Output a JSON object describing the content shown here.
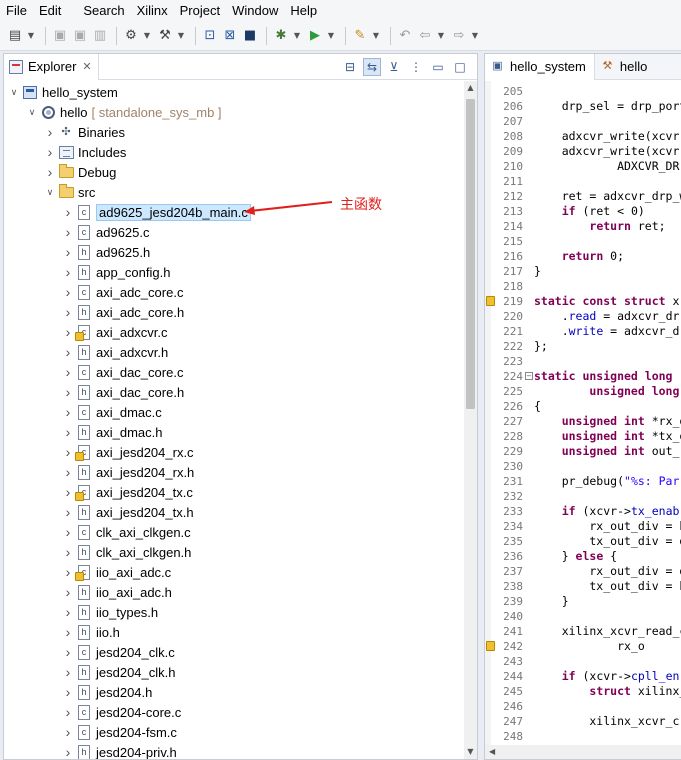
{
  "menu": [
    "File",
    "Edit",
    "Search",
    "Xilinx",
    "Project",
    "Window",
    "Help"
  ],
  "explorer": {
    "tab_label": "Explorer",
    "tree": [
      {
        "label": "hello_system",
        "sub": "",
        "icon": "project-icon",
        "depth": 0,
        "twisty": "expanded"
      },
      {
        "label": "hello",
        "sub": "[ standalone_sys_mb ]",
        "icon": "gear-icon",
        "depth": 1,
        "twisty": "expanded"
      },
      {
        "label": "Binaries",
        "sub": "",
        "icon": "binaries-icon",
        "depth": 2,
        "twisty": "collapsed"
      },
      {
        "label": "Includes",
        "sub": "",
        "icon": "includes-icon",
        "depth": 2,
        "twisty": "collapsed"
      },
      {
        "label": "Debug",
        "sub": "",
        "icon": "folder-icon",
        "depth": 2,
        "twisty": "collapsed"
      },
      {
        "label": "src",
        "sub": "",
        "icon": "folder-icon",
        "depth": 2,
        "twisty": "expanded"
      },
      {
        "label": "ad9625_jesd204b_main.c",
        "sub": "",
        "icon": "c-file-icon",
        "depth": 3,
        "twisty": "collapsed",
        "selected": true
      },
      {
        "label": "ad9625.c",
        "sub": "",
        "icon": "c-file-icon",
        "depth": 3,
        "twisty": "collapsed"
      },
      {
        "label": "ad9625.h",
        "sub": "",
        "icon": "h-file-icon",
        "depth": 3,
        "twisty": "collapsed"
      },
      {
        "label": "app_config.h",
        "sub": "",
        "icon": "h-file-icon",
        "depth": 3,
        "twisty": "collapsed"
      },
      {
        "label": "axi_adc_core.c",
        "sub": "",
        "icon": "c-file-icon",
        "depth": 3,
        "twisty": "collapsed"
      },
      {
        "label": "axi_adc_core.h",
        "sub": "",
        "icon": "h-file-icon",
        "depth": 3,
        "twisty": "collapsed"
      },
      {
        "label": "axi_adxcvr.c",
        "sub": "",
        "icon": "c-file-warning-icon",
        "depth": 3,
        "twisty": "collapsed"
      },
      {
        "label": "axi_adxcvr.h",
        "sub": "",
        "icon": "h-file-icon",
        "depth": 3,
        "twisty": "collapsed"
      },
      {
        "label": "axi_dac_core.c",
        "sub": "",
        "icon": "c-file-icon",
        "depth": 3,
        "twisty": "collapsed"
      },
      {
        "label": "axi_dac_core.h",
        "sub": "",
        "icon": "h-file-icon",
        "depth": 3,
        "twisty": "collapsed"
      },
      {
        "label": "axi_dmac.c",
        "sub": "",
        "icon": "c-file-icon",
        "depth": 3,
        "twisty": "collapsed"
      },
      {
        "label": "axi_dmac.h",
        "sub": "",
        "icon": "h-file-icon",
        "depth": 3,
        "twisty": "collapsed"
      },
      {
        "label": "axi_jesd204_rx.c",
        "sub": "",
        "icon": "c-file-warning-icon",
        "depth": 3,
        "twisty": "collapsed"
      },
      {
        "label": "axi_jesd204_rx.h",
        "sub": "",
        "icon": "h-file-icon",
        "depth": 3,
        "twisty": "collapsed"
      },
      {
        "label": "axi_jesd204_tx.c",
        "sub": "",
        "icon": "c-file-warning-icon",
        "depth": 3,
        "twisty": "collapsed"
      },
      {
        "label": "axi_jesd204_tx.h",
        "sub": "",
        "icon": "h-file-icon",
        "depth": 3,
        "twisty": "collapsed"
      },
      {
        "label": "clk_axi_clkgen.c",
        "sub": "",
        "icon": "c-file-icon",
        "depth": 3,
        "twisty": "collapsed"
      },
      {
        "label": "clk_axi_clkgen.h",
        "sub": "",
        "icon": "h-file-icon",
        "depth": 3,
        "twisty": "collapsed"
      },
      {
        "label": "iio_axi_adc.c",
        "sub": "",
        "icon": "c-file-warning-icon",
        "depth": 3,
        "twisty": "collapsed"
      },
      {
        "label": "iio_axi_adc.h",
        "sub": "",
        "icon": "h-file-icon",
        "depth": 3,
        "twisty": "collapsed"
      },
      {
        "label": "iio_types.h",
        "sub": "",
        "icon": "h-file-icon",
        "depth": 3,
        "twisty": "collapsed"
      },
      {
        "label": "iio.h",
        "sub": "",
        "icon": "h-file-icon",
        "depth": 3,
        "twisty": "collapsed"
      },
      {
        "label": "jesd204_clk.c",
        "sub": "",
        "icon": "c-file-icon",
        "depth": 3,
        "twisty": "collapsed"
      },
      {
        "label": "jesd204_clk.h",
        "sub": "",
        "icon": "h-file-icon",
        "depth": 3,
        "twisty": "collapsed"
      },
      {
        "label": "jesd204.h",
        "sub": "",
        "icon": "h-file-icon",
        "depth": 3,
        "twisty": "collapsed"
      },
      {
        "label": "jesd204-core.c",
        "sub": "",
        "icon": "c-file-icon",
        "depth": 3,
        "twisty": "collapsed"
      },
      {
        "label": "jesd204-fsm.c",
        "sub": "",
        "icon": "c-file-icon",
        "depth": 3,
        "twisty": "collapsed"
      },
      {
        "label": "jesd204-priv.h",
        "sub": "",
        "icon": "h-file-icon",
        "depth": 3,
        "twisty": "collapsed"
      }
    ]
  },
  "annotation": {
    "text": "主函数",
    "color": "#e0201c"
  },
  "editor": {
    "tabs": [
      {
        "label": "hello_system",
        "icon": "project-icon"
      },
      {
        "label": "hello",
        "icon": "hammer-icon"
      }
    ],
    "lines": [
      {
        "n": "205",
        "html": ""
      },
      {
        "n": "206",
        "html": "    drp_sel = drp_port"
      },
      {
        "n": "207",
        "html": ""
      },
      {
        "n": "208",
        "html": "    adxcvr_write(xcvr,"
      },
      {
        "n": "209",
        "html": "    adxcvr_write(xcvr,"
      },
      {
        "n": "210",
        "html": "            ADXCVR_DR"
      },
      {
        "n": "211",
        "html": ""
      },
      {
        "n": "212",
        "html": "    ret = adxcvr_drp_w"
      },
      {
        "n": "213",
        "html": "    <span class=\"kw\">if</span> (ret &lt; 0)"
      },
      {
        "n": "214",
        "html": "        <span class=\"kw\">return</span> ret;"
      },
      {
        "n": "215",
        "html": ""
      },
      {
        "n": "216",
        "html": "    <span class=\"kw\">return</span> 0;"
      },
      {
        "n": "217",
        "html": "}"
      },
      {
        "n": "218",
        "html": ""
      },
      {
        "n": "219",
        "html": "<span class=\"kw\">static const struct</span> x",
        "mark": true
      },
      {
        "n": "220",
        "html": "    .<span class=\"fld\">read</span> = adxcvr_dr"
      },
      {
        "n": "221",
        "html": "    .<span class=\"fld\">write</span> = adxcvr_d"
      },
      {
        "n": "222",
        "html": "};"
      },
      {
        "n": "223",
        "html": ""
      },
      {
        "n": "224",
        "html": "<span class=\"kw\">static unsigned long</span> ",
        "fold": true
      },
      {
        "n": "225",
        "html": "        <span class=\"kw\">unsigned long</span>"
      },
      {
        "n": "226",
        "html": "{"
      },
      {
        "n": "227",
        "html": "    <span class=\"kw\">unsigned int</span> *rx_o"
      },
      {
        "n": "228",
        "html": "    <span class=\"kw\">unsigned int</span> *tx_o"
      },
      {
        "n": "229",
        "html": "    <span class=\"kw\">unsigned int</span> out_"
      },
      {
        "n": "230",
        "html": ""
      },
      {
        "n": "231",
        "html": "    pr_debug(<span class=\"str\">\"%s: Par</span>"
      },
      {
        "n": "232",
        "html": ""
      },
      {
        "n": "233",
        "html": "    <span class=\"kw\">if</span> (xcvr-&gt;<span class=\"fld\">tx_enab</span>"
      },
      {
        "n": "234",
        "html": "        rx_out_div = h"
      },
      {
        "n": "235",
        "html": "        tx_out_div = d"
      },
      {
        "n": "236",
        "html": "    } <span class=\"kw\">else</span> {"
      },
      {
        "n": "237",
        "html": "        rx_out_div = d"
      },
      {
        "n": "238",
        "html": "        tx_out_div = h"
      },
      {
        "n": "239",
        "html": "    }"
      },
      {
        "n": "240",
        "html": ""
      },
      {
        "n": "241",
        "html": "    xilinx_xcvr_read_c"
      },
      {
        "n": "242",
        "html": "            rx_o",
        "mark": true
      },
      {
        "n": "243",
        "html": ""
      },
      {
        "n": "244",
        "html": "    <span class=\"kw\">if</span> (xcvr-&gt;<span class=\"fld\">cpll_en</span>"
      },
      {
        "n": "245",
        "html": "        <span class=\"kw\">struct</span> xilinx_"
      },
      {
        "n": "246",
        "html": ""
      },
      {
        "n": "247",
        "html": "        xilinx_xcvr_c"
      },
      {
        "n": "248",
        "html": ""
      }
    ]
  }
}
